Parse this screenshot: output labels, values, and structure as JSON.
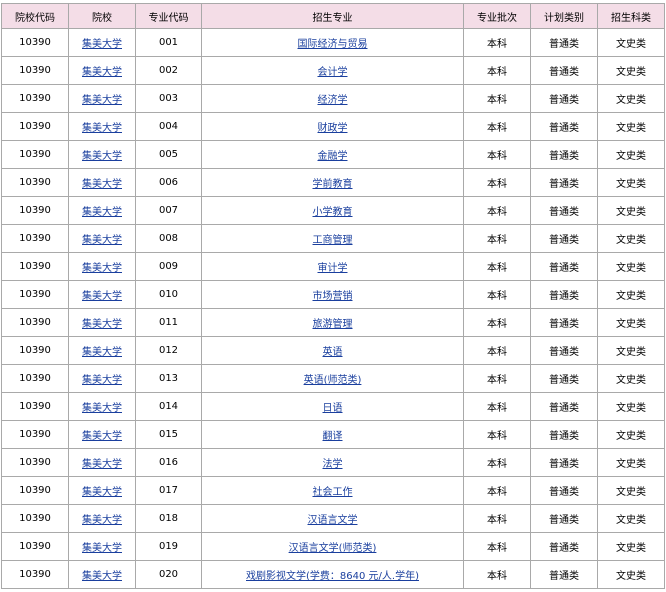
{
  "headers": [
    "院校代码",
    "院校",
    "专业代码",
    "招生专业",
    "专业批次",
    "计划类别",
    "招生科类"
  ],
  "rows": [
    {
      "school_code": "10390",
      "school": "集美大学",
      "major_code": "001",
      "major": "国际经济与贸易",
      "batch": "本科",
      "plan": "普通类",
      "category": "文史类"
    },
    {
      "school_code": "10390",
      "school": "集美大学",
      "major_code": "002",
      "major": "会计学",
      "batch": "本科",
      "plan": "普通类",
      "category": "文史类"
    },
    {
      "school_code": "10390",
      "school": "集美大学",
      "major_code": "003",
      "major": "经济学",
      "batch": "本科",
      "plan": "普通类",
      "category": "文史类"
    },
    {
      "school_code": "10390",
      "school": "集美大学",
      "major_code": "004",
      "major": "财政学",
      "batch": "本科",
      "plan": "普通类",
      "category": "文史类"
    },
    {
      "school_code": "10390",
      "school": "集美大学",
      "major_code": "005",
      "major": "金融学",
      "batch": "本科",
      "plan": "普通类",
      "category": "文史类"
    },
    {
      "school_code": "10390",
      "school": "集美大学",
      "major_code": "006",
      "major": "学前教育",
      "batch": "本科",
      "plan": "普通类",
      "category": "文史类"
    },
    {
      "school_code": "10390",
      "school": "集美大学",
      "major_code": "007",
      "major": "小学教育",
      "batch": "本科",
      "plan": "普通类",
      "category": "文史类"
    },
    {
      "school_code": "10390",
      "school": "集美大学",
      "major_code": "008",
      "major": "工商管理",
      "batch": "本科",
      "plan": "普通类",
      "category": "文史类"
    },
    {
      "school_code": "10390",
      "school": "集美大学",
      "major_code": "009",
      "major": "审计学",
      "batch": "本科",
      "plan": "普通类",
      "category": "文史类"
    },
    {
      "school_code": "10390",
      "school": "集美大学",
      "major_code": "010",
      "major": "市场营销",
      "batch": "本科",
      "plan": "普通类",
      "category": "文史类"
    },
    {
      "school_code": "10390",
      "school": "集美大学",
      "major_code": "011",
      "major": "旅游管理",
      "batch": "本科",
      "plan": "普通类",
      "category": "文史类"
    },
    {
      "school_code": "10390",
      "school": "集美大学",
      "major_code": "012",
      "major": "英语",
      "batch": "本科",
      "plan": "普通类",
      "category": "文史类"
    },
    {
      "school_code": "10390",
      "school": "集美大学",
      "major_code": "013",
      "major": "英语(师范类)",
      "batch": "本科",
      "plan": "普通类",
      "category": "文史类"
    },
    {
      "school_code": "10390",
      "school": "集美大学",
      "major_code": "014",
      "major": "日语",
      "batch": "本科",
      "plan": "普通类",
      "category": "文史类"
    },
    {
      "school_code": "10390",
      "school": "集美大学",
      "major_code": "015",
      "major": "翻译",
      "batch": "本科",
      "plan": "普通类",
      "category": "文史类"
    },
    {
      "school_code": "10390",
      "school": "集美大学",
      "major_code": "016",
      "major": "法学",
      "batch": "本科",
      "plan": "普通类",
      "category": "文史类"
    },
    {
      "school_code": "10390",
      "school": "集美大学",
      "major_code": "017",
      "major": "社会工作",
      "batch": "本科",
      "plan": "普通类",
      "category": "文史类"
    },
    {
      "school_code": "10390",
      "school": "集美大学",
      "major_code": "018",
      "major": "汉语言文学",
      "batch": "本科",
      "plan": "普通类",
      "category": "文史类"
    },
    {
      "school_code": "10390",
      "school": "集美大学",
      "major_code": "019",
      "major": "汉语言文学(师范类)",
      "batch": "本科",
      "plan": "普通类",
      "category": "文史类"
    },
    {
      "school_code": "10390",
      "school": "集美大学",
      "major_code": "020",
      "major": "戏剧影视文学(学费：8640 元/人.学年)",
      "batch": "本科",
      "plan": "普通类",
      "category": "文史类"
    }
  ],
  "colors": {
    "header_bg": "#f4dde7",
    "border": "#a9a9a9",
    "link": "#1a3f9e"
  }
}
